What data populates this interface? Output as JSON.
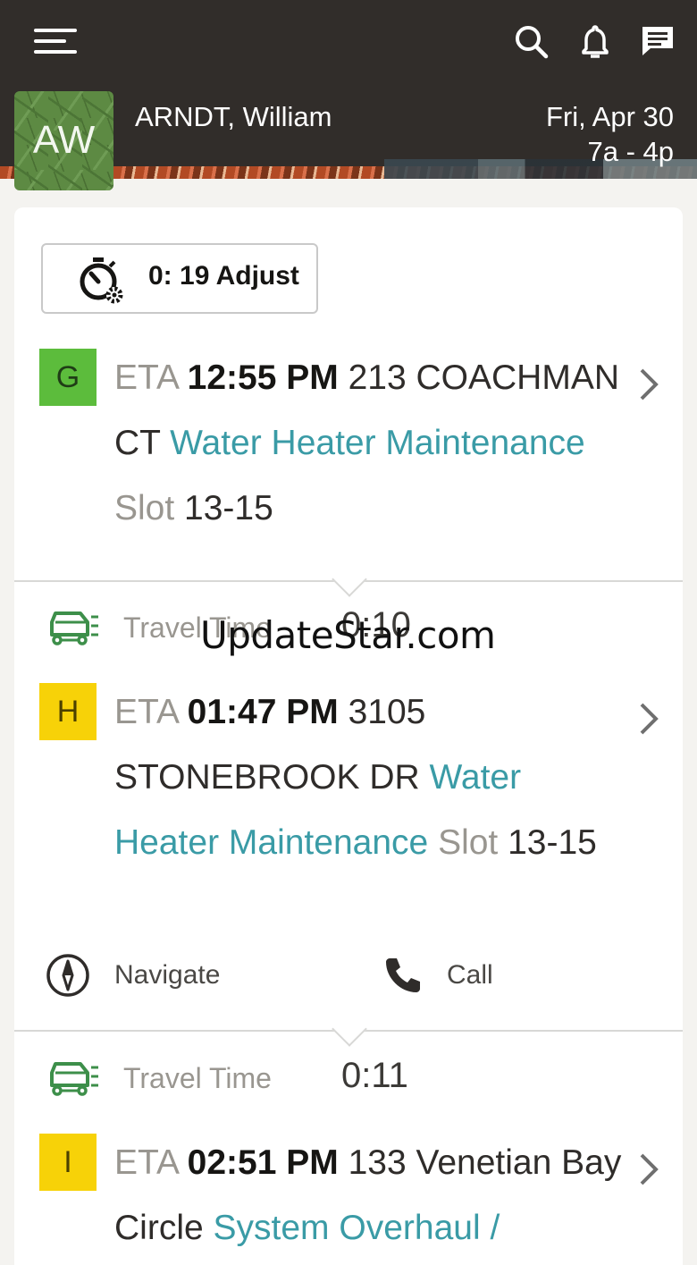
{
  "header": {
    "menu_icon": "hamburger-menu-icon",
    "icons": [
      "search-icon",
      "bell-icon",
      "chat-icon"
    ],
    "avatar_initials": "AW",
    "user_name": "ARNDT, William",
    "date": "Fri, Apr 30",
    "shift": "7a - 4p"
  },
  "adjust_button": {
    "icon": "stopwatch-gear-icon",
    "label": "0: 19 Adjust"
  },
  "activities": [
    {
      "badge": "G",
      "badge_color": "#5cbc3c",
      "eta_label": "ETA",
      "eta": "12:55 PM",
      "address": "213 COACHMAN CT",
      "type": "Water Heater Maintenance",
      "slot_label": "Slot",
      "slot": "13-15"
    },
    {
      "badge": "H",
      "badge_color": "#f7d208",
      "eta_label": "ETA",
      "eta": "01:47 PM",
      "address": "3105 STONEBROOK DR",
      "type": "Water Heater Maintenance",
      "slot_label": "Slot",
      "slot": "13-15",
      "actions": {
        "navigate": "Navigate",
        "call": "Call"
      }
    },
    {
      "badge": "I",
      "badge_color": "#f7d208",
      "eta_label": "ETA",
      "eta": "02:51 PM",
      "address": "133 Venetian Bay Circle",
      "type": "System Overhaul /"
    }
  ],
  "travel": [
    {
      "label": "Travel Time",
      "value": "0:10"
    },
    {
      "label": "Travel Time",
      "value": "0:11"
    }
  ],
  "watermark": "UpdateStar.com"
}
